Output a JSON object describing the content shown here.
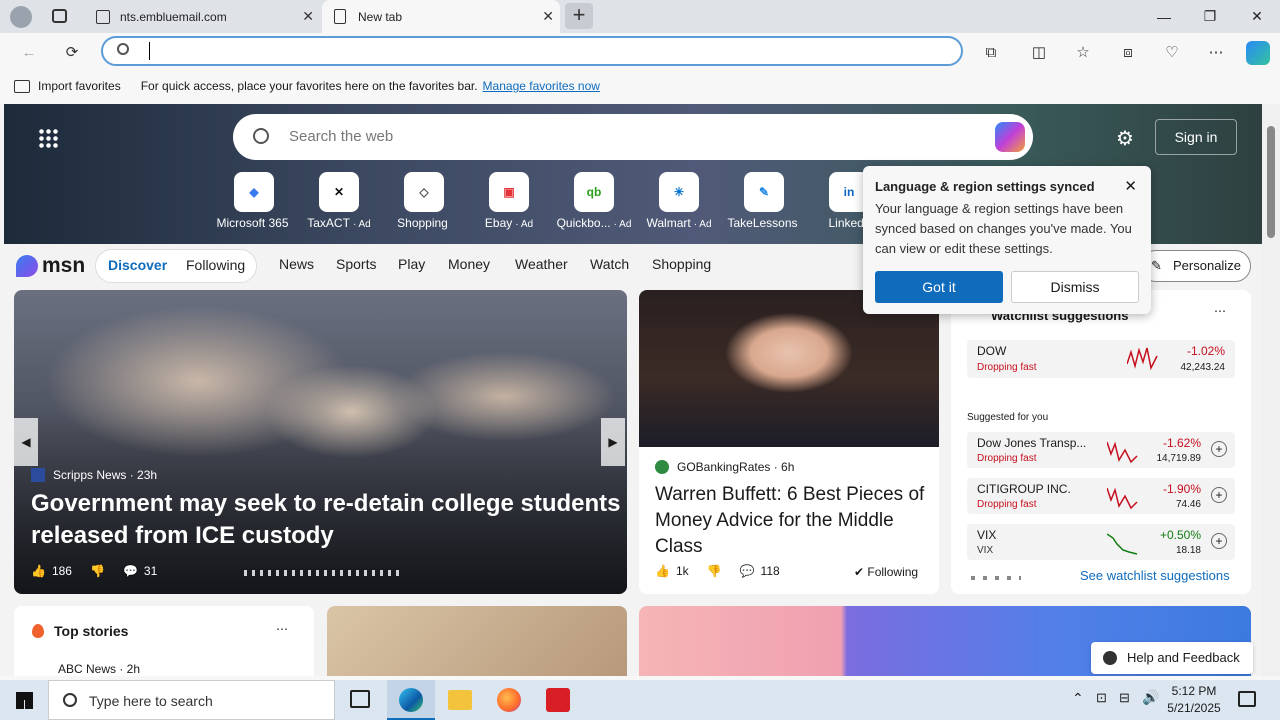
{
  "tabs": [
    {
      "title": "nts.embluemail.com"
    },
    {
      "title": "New tab"
    }
  ],
  "address": {
    "value": ""
  },
  "favorites": {
    "import": "Import favorites",
    "hint": "For quick access, place your favorites here on the favorites bar.",
    "manage": "Manage favorites now"
  },
  "search": {
    "placeholder": "Search the web"
  },
  "signin": "Sign in",
  "quicklinks": [
    {
      "label": "Microsoft 365",
      "ad": ""
    },
    {
      "label": "TaxACT",
      "ad": "· Ad"
    },
    {
      "label": "Shopping",
      "ad": ""
    },
    {
      "label": "Ebay",
      "ad": "· Ad"
    },
    {
      "label": "Quickbo...",
      "ad": "· Ad"
    },
    {
      "label": "Walmart",
      "ad": "· Ad"
    },
    {
      "label": "TakeLessons",
      "ad": ""
    },
    {
      "label": "Linkedl",
      "ad": ""
    }
  ],
  "msn": {
    "logo": "msn",
    "pills": [
      "Discover",
      "Following"
    ],
    "nav": [
      "News",
      "Sports",
      "Play",
      "Money",
      "Weather",
      "Watch",
      "Shopping"
    ],
    "personalize": "Personalize"
  },
  "hero": {
    "source": "Scripps News · 23h",
    "headline": "Government may seek to re-detain college students released from ICE custody",
    "likes": "186",
    "comments": "31"
  },
  "buffett": {
    "source": "GOBankingRates · 6h",
    "headline": "Warren Buffett: 6 Best Pieces of Money Advice for the Middle Class",
    "likes": "1k",
    "comments": "118",
    "following": "Following"
  },
  "popup": {
    "title": "Language & region settings synced",
    "body": "Your language & region settings have been synced based on changes you've made. You can view or edit these settings.",
    "ok": "Got it",
    "dismiss": "Dismiss"
  },
  "watchlist": {
    "title": "Watchlist suggestions",
    "dow": {
      "name": "DOW",
      "status": "Dropping fast",
      "change": "-1.02%",
      "value": "42,243.24"
    },
    "suggested_label": "Suggested for you",
    "items": [
      {
        "name": "Dow Jones Transp...",
        "status": "Dropping fast",
        "change": "-1.62%",
        "value": "14,719.89"
      },
      {
        "name": "CITIGROUP INC.",
        "status": "Dropping fast",
        "change": "-1.90%",
        "value": "74.46"
      },
      {
        "name": "VIX",
        "status": "VIX",
        "change": "+0.50%",
        "value": "18.18"
      }
    ],
    "see": "See watchlist suggestions"
  },
  "topstories": {
    "title": "Top stories",
    "source": "ABC News · 2h"
  },
  "help": "Help and Feedback",
  "taskbar": {
    "search": "Type here to search",
    "time": "5:12 PM",
    "date": "5/21/2025"
  },
  "colors": {
    "accent": "#0f6cbd",
    "red": "#c50f1f",
    "green": "#107c10"
  }
}
